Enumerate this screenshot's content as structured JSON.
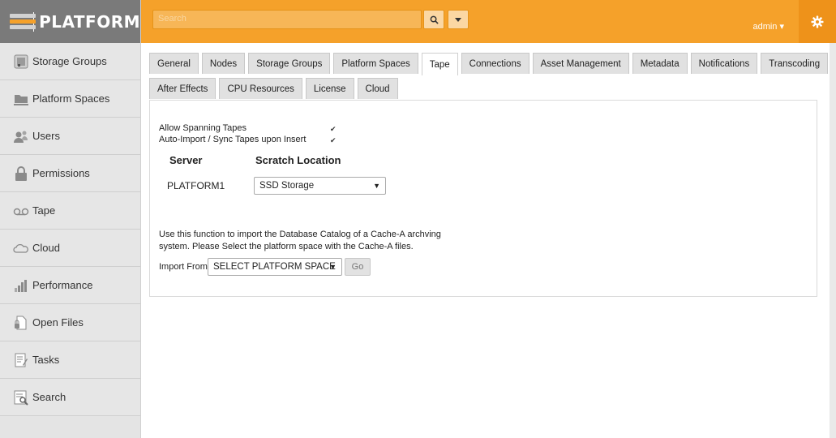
{
  "logo": {
    "text": "PLATFORM"
  },
  "sidebar": {
    "items": [
      {
        "label": "Storage Groups",
        "icon": "storage-icon"
      },
      {
        "label": "Platform Spaces",
        "icon": "folder-icon"
      },
      {
        "label": "Users",
        "icon": "users-icon"
      },
      {
        "label": "Permissions",
        "icon": "lock-icon"
      },
      {
        "label": "Tape",
        "icon": "tape-icon"
      },
      {
        "label": "Cloud",
        "icon": "cloud-icon"
      },
      {
        "label": "Performance",
        "icon": "performance-icon"
      },
      {
        "label": "Open Files",
        "icon": "open-files-icon"
      },
      {
        "label": "Tasks",
        "icon": "tasks-icon"
      },
      {
        "label": "Search",
        "icon": "search-icon"
      }
    ]
  },
  "topbar": {
    "search_placeholder": "Search",
    "user": "admin ▾",
    "accent": "#f5a12a"
  },
  "tabs": {
    "row1": [
      "General",
      "Nodes",
      "Storage Groups",
      "Platform Spaces",
      "Tape",
      "Connections",
      "Asset Management",
      "Metadata",
      "Notifications",
      "Transcoding"
    ],
    "row2": [
      "After Effects",
      "CPU Resources",
      "License",
      "Cloud"
    ],
    "active": "Tape"
  },
  "tape": {
    "allow_spanning_label": "Allow Spanning Tapes",
    "allow_spanning_checked": true,
    "auto_import_label": "Auto-Import / Sync Tapes upon Insert",
    "auto_import_checked": true,
    "col_server": "Server",
    "col_scratch": "Scratch Location",
    "server_name": "PLATFORM1",
    "scratch_value": "SSD Storage",
    "description": "Use this function to import the Database Catalog of a Cache-A archving system. Please Select the platform space with the Cache-A files.",
    "import_from_label": "Import From",
    "import_from_value": "SELECT PLATFORM SPACE",
    "go_label": "Go"
  }
}
